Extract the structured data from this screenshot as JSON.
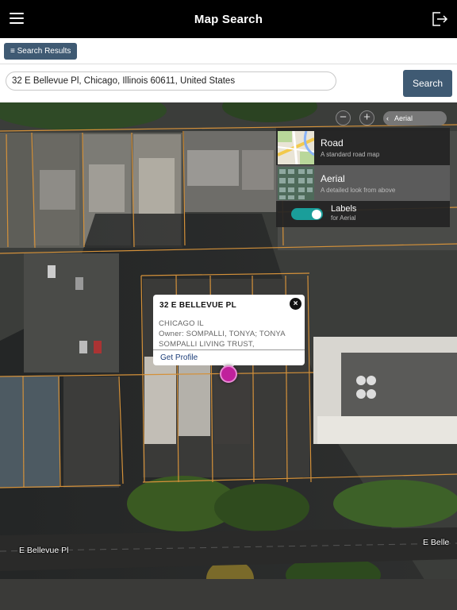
{
  "header": {
    "title": "Map Search",
    "menu_icon": "hamburger-menu-icon",
    "logout_icon": "logout-icon"
  },
  "results": {
    "button_label": "≡ Search Results"
  },
  "search": {
    "value": "32 E Bellevue Pl, Chicago, Illinois 60611, United States",
    "button_label": "Search"
  },
  "map": {
    "zoom_out": "−",
    "zoom_in": "+",
    "layer_toggle": {
      "chevron": "‹",
      "label": "Aerial"
    },
    "layers": [
      {
        "title": "Road",
        "subtitle": "A standard road map",
        "selected": false
      },
      {
        "title": "Aerial",
        "subtitle": "A detailed look from above",
        "selected": true
      }
    ],
    "labels": {
      "title": "Labels",
      "subtitle": "for Aerial",
      "enabled": true
    },
    "streets": [
      "E Bellevue Pl",
      "E Belle"
    ]
  },
  "popup": {
    "title": "32 E BELLEVUE PL",
    "close": "×",
    "lines": [
      "CHICAGO IL",
      "Owner: SOMPALLI, TONYA; TONYA",
      "SOMPALLI LIVING TRUST,"
    ],
    "link": "Get Profile"
  },
  "colors": {
    "accent": "#3f5a73",
    "pin": "#c0219c",
    "toggle": "#1a9e9a",
    "parcel_line": "#d4913a"
  }
}
